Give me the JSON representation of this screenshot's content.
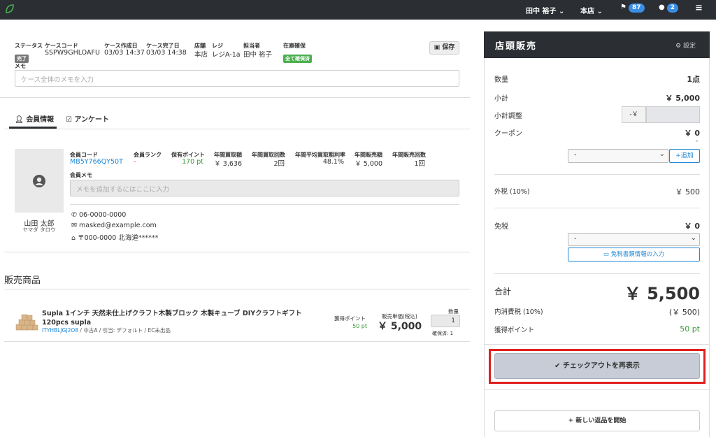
{
  "topbar": {
    "user": "田中 裕子",
    "store": "本店",
    "flag_count": "87",
    "chat_count": "2"
  },
  "case": {
    "status_label": "ステータス",
    "status": "完了",
    "code_label": "ケースコード",
    "code": "SSPW9GHLOAFU",
    "created_label": "ケース作成日",
    "created": "03/03 14:37",
    "completed_label": "ケース完了日",
    "completed": "03/03 14:38",
    "store_label": "店舗",
    "store": "本店",
    "register_label": "レジ",
    "register": "レジA-1a",
    "staff_label": "担当者",
    "staff": "田中 裕子",
    "stock_label": "在庫確保",
    "stock": "全て確保済",
    "save": "保存",
    "memo_label": "メモ",
    "memo_placeholder": "ケース全体のメモを入力"
  },
  "tabs": [
    "会員情報",
    "アンケート"
  ],
  "member": {
    "name": "山田 太郎",
    "kana": "ヤマダ タロウ",
    "code_label": "会員コード",
    "code": "MB5Y766QY50T",
    "rank_label": "会員ランク",
    "rank": "-",
    "points_label": "保有ポイント",
    "points": "170 pt",
    "buy_amount_label": "年間買取額",
    "buy_amount": "￥ 3,636",
    "buy_count_label": "年間買取回数",
    "buy_count": "2回",
    "margin_label": "年間平均買取粗利率",
    "margin": "48.1%",
    "sale_amount_label": "年間販売額",
    "sale_amount": "￥ 5,000",
    "sale_count_label": "年間販売回数",
    "sale_count": "1回",
    "memo_label": "会員メモ",
    "memo_placeholder": "メモを追加するにはここに入力",
    "phone": "06-0000-0000",
    "email": "masked@example.com",
    "address": "〒000-0000 北海道******"
  },
  "items": {
    "heading": "販売商品",
    "list": [
      {
        "name": "Supla 1インチ 天然未仕上げクラフト木製ブロック 木製キューブ DIYクラフトギフト 120pcs supla",
        "code": "ITYHBLJGJ2O8",
        "meta": " / 中古A / 引当: デフォルト / EC未出品",
        "points_label": "獲得ポイント",
        "points": "50 pt",
        "price_label": "販売単価(税込)",
        "price": "￥ 5,000",
        "qty_label": "数量",
        "qty": "1",
        "reserved": "確保済: 1"
      }
    ]
  },
  "pos": {
    "title": "店頭販売",
    "settings": "設定",
    "qty_label": "数量",
    "qty": "1点",
    "subtotal_label": "小計",
    "subtotal": "￥ 5,000",
    "adjust_label": "小計調整",
    "adjust_prefix": "-￥",
    "coupon_label": "クーポン",
    "coupon": "￥ 0",
    "coupon_sub": "-",
    "coupon_select": "-",
    "coupon_add": "追加",
    "tax_label": "外税 (10%)",
    "tax": "￥ 500",
    "exempt_label": "免税",
    "exempt": "￥ 0",
    "exempt_select": "-",
    "exempt_btn": "免税書類情報の入力",
    "total_label": "合計",
    "total": "￥ 5,500",
    "incl_tax_label": "内消費税 (10%)",
    "incl_tax": "(￥ 500)",
    "earn_label": "獲得ポイント",
    "earn": "50 pt",
    "checkout": "チェックアウトを再表示",
    "new_return": "新しい返品を開始"
  },
  "colors": {
    "status_tag": "#777777",
    "stock_tag": "#4caf50",
    "highlight": "#e02020",
    "dark": "#2b2e33",
    "link": "#1e88d6",
    "green": "#3a9a3a"
  }
}
